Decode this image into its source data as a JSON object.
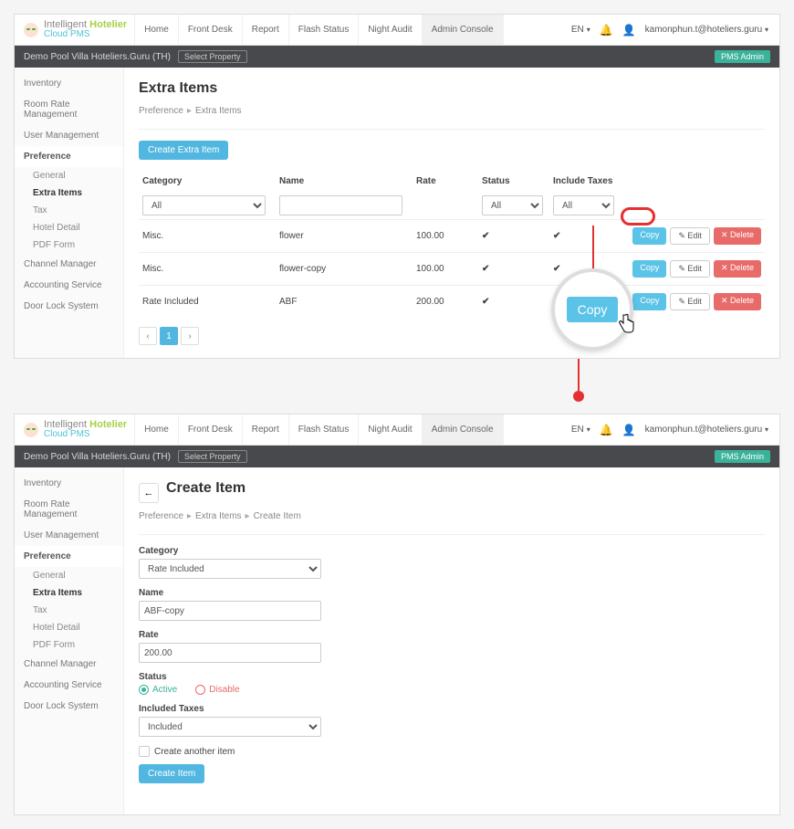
{
  "global": {
    "logo_line1a": "Intelligent ",
    "logo_line1b": "Hotelier",
    "logo_line2": "Cloud PMS",
    "nav": [
      "Home",
      "Front Desk",
      "Report",
      "Flash Status",
      "Night Audit",
      "Admin Console"
    ],
    "lang": "EN",
    "user": "kamonphun.t@hoteliers.guru",
    "property": "Demo Pool Villa Hoteliers.Guru (TH)",
    "select_property": "Select Property",
    "pms_admin": "PMS Admin",
    "sidebar": {
      "items": [
        "Inventory",
        "Room Rate Management",
        "User Management",
        "Preference",
        "Channel Manager",
        "Accounting Service",
        "Door Lock System"
      ],
      "pref_subs": [
        "General",
        "Extra Items",
        "Tax",
        "Hotel Detail",
        "PDF Form"
      ]
    }
  },
  "screen1": {
    "title": "Extra Items",
    "crumb": [
      "Preference",
      "Extra Items"
    ],
    "create_btn": "Create Extra Item",
    "columns": [
      "Category",
      "Name",
      "Rate",
      "Status",
      "Include Taxes"
    ],
    "filter_all": "All",
    "rows": [
      {
        "cat": "Misc.",
        "name": "flower",
        "rate": "100.00",
        "status": true,
        "tax": true
      },
      {
        "cat": "Misc.",
        "name": "flower-copy",
        "rate": "100.00",
        "status": true,
        "tax": true
      },
      {
        "cat": "Rate Included",
        "name": "ABF",
        "rate": "200.00",
        "status": true,
        "tax": true
      }
    ],
    "actions": {
      "copy": "Copy",
      "edit": "Edit",
      "delete": "Delete"
    },
    "zoom_label": "Copy"
  },
  "screen2": {
    "title": "Create Item",
    "crumb": [
      "Preference",
      "Extra Items",
      "Create Item"
    ],
    "labels": {
      "category": "Category",
      "name": "Name",
      "rate": "Rate",
      "status": "Status",
      "included_taxes": "Included Taxes",
      "create_another": "Create another item",
      "active": "Active",
      "disable": "Disable",
      "included": "Included"
    },
    "values": {
      "category": "Rate Included",
      "name": "ABF-copy",
      "rate": "200.00",
      "included_taxes": "Included"
    },
    "submit": "Create Item"
  }
}
